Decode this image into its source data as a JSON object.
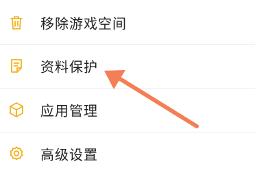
{
  "accent_color": "#F2B21F",
  "arrow_color": "#F47E55",
  "menu": {
    "items": [
      {
        "label": "移除游戏空间",
        "icon": "trash-icon"
      },
      {
        "label": "资料保护",
        "icon": "document-icon"
      },
      {
        "label": "应用管理",
        "icon": "cube-icon"
      },
      {
        "label": "高级设置",
        "icon": "gear-icon"
      }
    ]
  }
}
